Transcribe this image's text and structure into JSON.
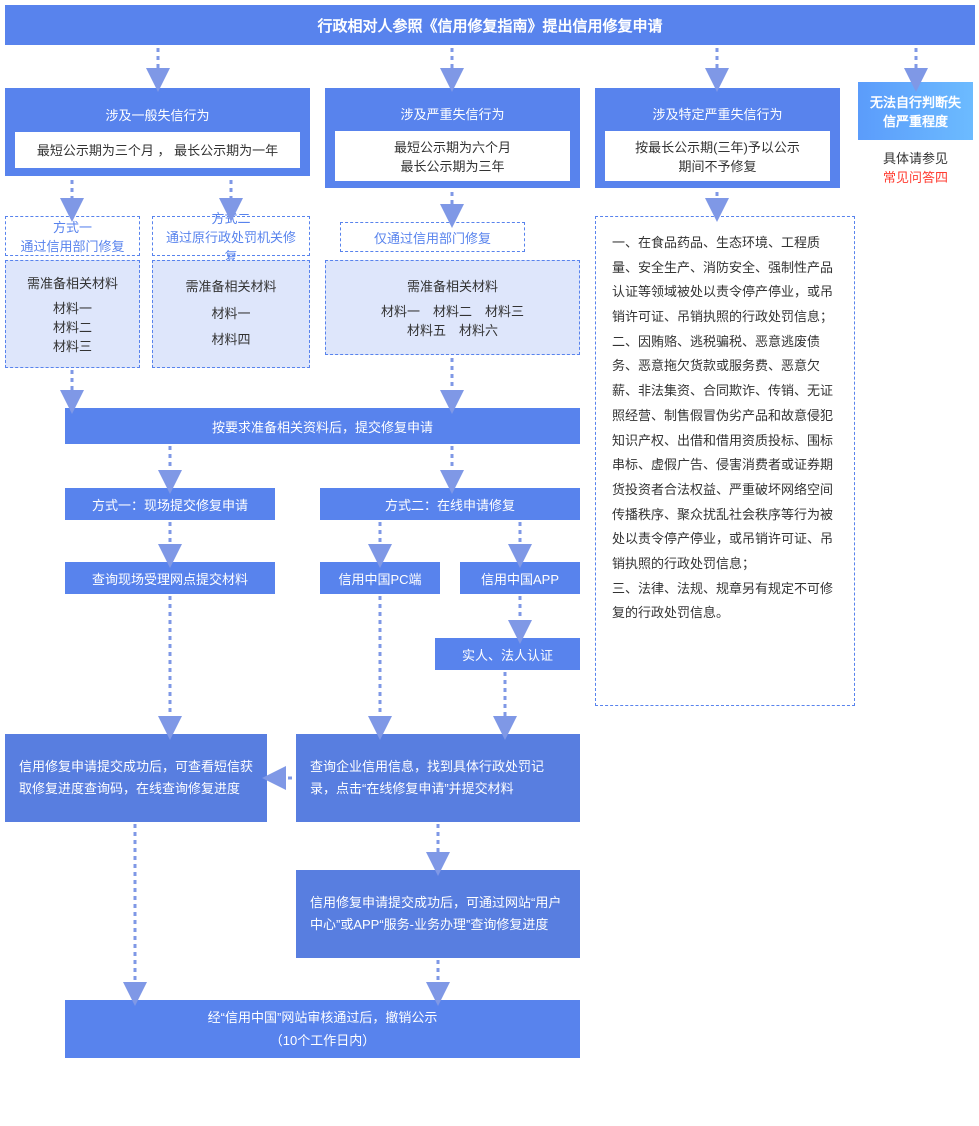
{
  "header": "行政相对人参照《信用修复指南》提出信用修复申请",
  "col1": {
    "title": "涉及一般失信行为",
    "sub": "最短公示期为三个月 ， 最长公示期为一年"
  },
  "col2": {
    "title": "涉及严重失信行为",
    "sub1": "最短公示期为六个月",
    "sub2": "最长公示期为三年"
  },
  "col3": {
    "title": "涉及特定严重失信行为",
    "sub1": "按最长公示期(三年)予以公示",
    "sub2": "期间不予修复"
  },
  "faq": {
    "title": "无法自行判断失信严重程度",
    "line1": "具体请参见",
    "line2": "常见问答四"
  },
  "m1": {
    "title1": "方式一",
    "title2": "通过信用部门修复",
    "hdr": "需准备相关材料",
    "i1": "材料一",
    "i2": "材料二",
    "i3": "材料三"
  },
  "m2": {
    "title1": "方式二",
    "title2": "通过原行政处罚机关修复",
    "hdr": "需准备相关材料",
    "i1": "材料一",
    "i2": "材料四"
  },
  "m3": {
    "title": "仅通过信用部门修复",
    "hdr": "需准备相关材料",
    "row1": "材料一　材料二　材料三",
    "row2": "材料五　材料六"
  },
  "prep": "按要求准备相关资料后，提交修复申请",
  "way1": "方式一：现场提交修复申请",
  "way2": "方式二：在线申请修复",
  "query_offline": "查询现场受理网点提交材料",
  "pc": "信用中国PC端",
  "app": "信用中国APP",
  "auth": "实人、法人认证",
  "left_note": "信用修复申请提交成功后，可查看短信获取修复进度查询码，在线查询修复进度",
  "right_note1": "查询企业信用信息，找到具体行政处罚记录，点击“在线修复申请”并提交材料",
  "right_note2": "信用修复申请提交成功后，可通过网站“用户中心”或APP“服务-业务办理”查询修复进度",
  "final1": "经“信用中国”网站审核通过后，撤销公示",
  "final2": "（10个工作日内）",
  "big": "一、在食品药品、生态环境、工程质量、安全生产、消防安全、强制性产品认证等领域被处以责令停产停业，或吊销许可证、吊销执照的行政处罚信息；\n二、因贿赂、逃税骗税、恶意逃废债务、恶意拖欠货款或服务费、恶意欠薪、非法集资、合同欺诈、传销、无证照经营、制售假冒伪劣产品和故意侵犯知识产权、出借和借用资质投标、围标串标、虚假广告、侵害消费者或证券期货投资者合法权益、严重破坏网络空间传播秩序、聚众扰乱社会秩序等行为被处以责令停产停业，或吊销许可证、吊销执照的行政处罚信息；\n三、法律、法规、规章另有规定不可修复的行政处罚信息。"
}
